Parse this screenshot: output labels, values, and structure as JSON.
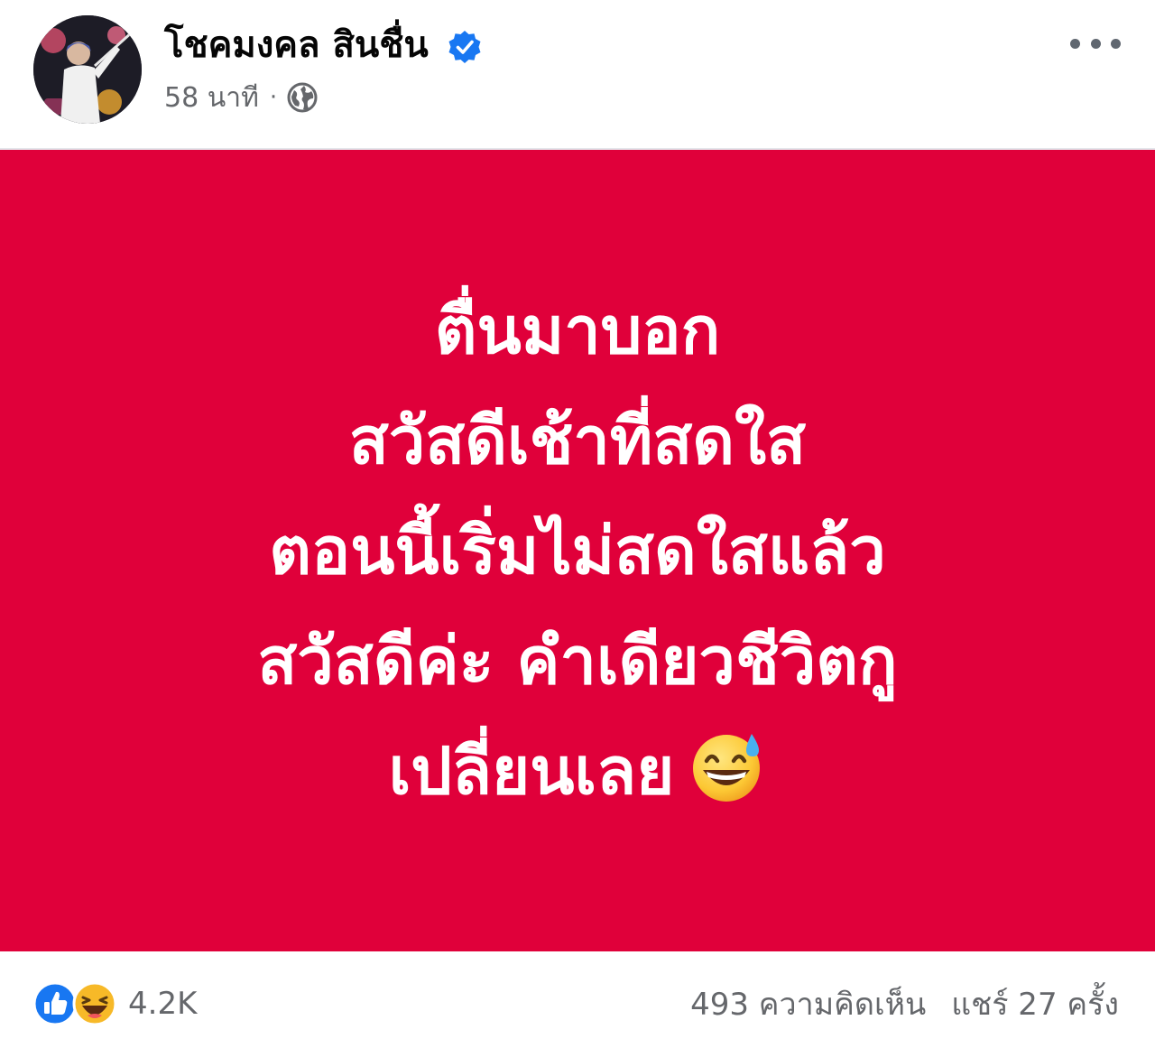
{
  "post": {
    "author": {
      "name": "โชคมงคล สินชื่น",
      "verified": true
    },
    "timestamp": "58 นาที",
    "separator": "·",
    "privacy_icon": "globe-icon",
    "more_icon": "more-horizontal-icon",
    "background_color": "#e0003a",
    "text_lines": [
      "ตื่นมาบอก",
      "สวัสดีเช้าที่สดใส",
      "ตอนนี้เริ่มไม่สดใสแล้ว",
      "สวัสดีค่ะ คำเดียวชีวิตกู",
      "เปลี่ยนเลย"
    ],
    "emoji": "grinning-face-with-sweat-icon"
  },
  "footer": {
    "reaction_icons": [
      "like-icon",
      "haha-icon"
    ],
    "reaction_count": "4.2K",
    "comments": "493 ความคิดเห็น",
    "shares": "แชร์ 27 ครั้ง"
  }
}
